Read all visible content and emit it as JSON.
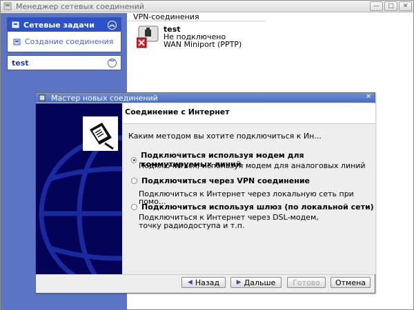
{
  "main": {
    "title": "Менеджер сетевых соединений",
    "window_buttons": [
      "—",
      "□",
      "✕"
    ]
  },
  "task_pane": {
    "network_tasks": {
      "title": "Сетевые задачи",
      "chevron": "︽",
      "items": [
        {
          "label": "Создание соединения"
        }
      ]
    },
    "test_group": {
      "title": "test",
      "chevron": "︾"
    }
  },
  "connections": {
    "header": "VPN-соединения",
    "items": [
      {
        "name": "test",
        "status": "Не подключено",
        "device": "WAN Miniport (PPTP)"
      }
    ]
  },
  "dialog": {
    "title": "Мастер новых соединений",
    "close": "✕",
    "heading": "Соединение с Интернет",
    "question": "Каким методом вы хотите подключиться к Ин...",
    "options": [
      {
        "label": "Подключиться используя модем для коммутируемых линий",
        "desc1": "Подключиться, используя модем для аналоговых линий",
        "desc2": "",
        "selected": true
      },
      {
        "label": "Подключиться через VPN соединение",
        "desc1": "Подключиться к Интернет через локальную сеть при помо...",
        "desc2": "",
        "selected": false
      },
      {
        "label": "Подключиться используя шлюз (по локальной сети)",
        "desc1": "Подключиться к Интернет через DSL-модем,",
        "desc2": "точку радиодоступа и т.п.",
        "selected": false
      }
    ],
    "buttons": {
      "back": "Назад",
      "next": "Дальше",
      "finish": "Готово",
      "cancel": "Отмена"
    }
  }
}
